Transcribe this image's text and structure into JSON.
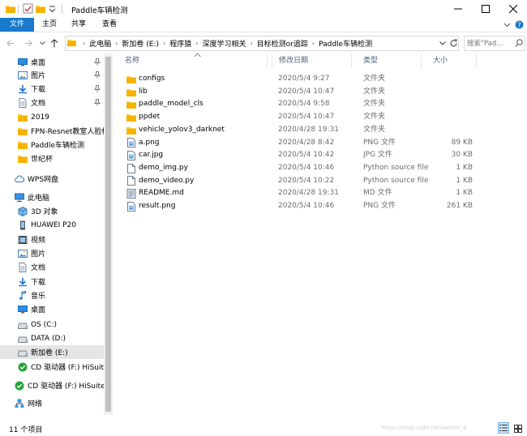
{
  "window": {
    "title": "Paddle车辆检测",
    "colors": {
      "accent": "#1979ca",
      "folder": "#ffc83d",
      "text": "#000000",
      "muted": "#6d6d6d"
    }
  },
  "ribbon": {
    "tabs": [
      "文件",
      "主页",
      "共享",
      "查看"
    ]
  },
  "address": {
    "breadcrumbs": [
      "此电脑",
      "新加卷 (E:)",
      "程序猿",
      "深度学习相关",
      "目标检测or追踪",
      "Paddle车辆检测"
    ],
    "search_placeholder": "搜索\"Pad..."
  },
  "nav": {
    "items": [
      {
        "label": "桌面",
        "icon": "desktop-icon",
        "pinned": true
      },
      {
        "label": "图片",
        "icon": "pictures-icon",
        "pinned": true
      },
      {
        "label": "下载",
        "icon": "download-icon",
        "pinned": true
      },
      {
        "label": "文档",
        "icon": "documents-icon",
        "pinned": true
      },
      {
        "label": "2019",
        "icon": "folder-icon"
      },
      {
        "label": "FPN-Resnet教室人脸检",
        "icon": "folder-icon"
      },
      {
        "label": "Paddle车辆检测",
        "icon": "folder-icon"
      },
      {
        "label": "世纪杯",
        "icon": "folder-icon"
      },
      {
        "label": "WPS网盘",
        "icon": "cloud-icon"
      },
      {
        "label": "此电脑",
        "icon": "computer-icon"
      },
      {
        "label": "3D 对象",
        "icon": "3d-objects-icon"
      },
      {
        "label": "HUAWEI P20",
        "icon": "phone-icon"
      },
      {
        "label": "视频",
        "icon": "video-icon"
      },
      {
        "label": "图片",
        "icon": "pictures-icon"
      },
      {
        "label": "文档",
        "icon": "documents-icon"
      },
      {
        "label": "下载",
        "icon": "download-icon"
      },
      {
        "label": "音乐",
        "icon": "music-icon"
      },
      {
        "label": "桌面",
        "icon": "desktop-icon"
      },
      {
        "label": "OS (C:)",
        "icon": "drive-icon"
      },
      {
        "label": "DATA (D:)",
        "icon": "drive-icon"
      },
      {
        "label": "新加卷 (E:)",
        "icon": "drive-icon",
        "selected": true
      },
      {
        "label": "CD 驱动器 (F:) HiSuite",
        "icon": "hisuite-icon"
      },
      {
        "label": "CD 驱动器 (F:) HiSuite",
        "icon": "hisuite-icon"
      },
      {
        "label": "网络",
        "icon": "network-icon"
      }
    ]
  },
  "columns": {
    "name": "名称",
    "date": "修改日期",
    "type": "类型",
    "size": "大小"
  },
  "files": [
    {
      "name": "configs",
      "date": "2020/5/4 9:27",
      "type": "文件夹",
      "size": "",
      "icon": "folder-icon"
    },
    {
      "name": "lib",
      "date": "2020/5/4 10:47",
      "type": "文件夹",
      "size": "",
      "icon": "folder-icon"
    },
    {
      "name": "paddle_model_cls",
      "date": "2020/5/4 9:58",
      "type": "文件夹",
      "size": "",
      "icon": "folder-icon"
    },
    {
      "name": "ppdet",
      "date": "2020/5/4 10:47",
      "type": "文件夹",
      "size": "",
      "icon": "folder-icon"
    },
    {
      "name": "vehicle_yolov3_darknet",
      "date": "2020/4/28 19:31",
      "type": "文件夹",
      "size": "",
      "icon": "folder-icon"
    },
    {
      "name": "a.png",
      "date": "2020/4/28 8:42",
      "type": "PNG 文件",
      "size": "89 KB",
      "icon": "image-file-icon"
    },
    {
      "name": "car.jpg",
      "date": "2020/5/4 10:42",
      "type": "JPG 文件",
      "size": "30 KB",
      "icon": "image-file-icon"
    },
    {
      "name": "demo_img.py",
      "date": "2020/5/4 10:46",
      "type": "Python source file",
      "size": "1 KB",
      "icon": "file-icon"
    },
    {
      "name": "demo_video.py",
      "date": "2020/5/4 10:22",
      "type": "Python source file",
      "size": "1 KB",
      "icon": "file-icon"
    },
    {
      "name": "README.md",
      "date": "2020/4/28 19:31",
      "type": "MD 文件",
      "size": "1 KB",
      "icon": "text-file-icon"
    },
    {
      "name": "result.png",
      "date": "2020/5/4 10:46",
      "type": "PNG 文件",
      "size": "261 KB",
      "icon": "image-file-icon"
    }
  ],
  "status": {
    "item_count": "11 个项目",
    "watermark": "https://blog.csdn.net/weixin_4"
  }
}
